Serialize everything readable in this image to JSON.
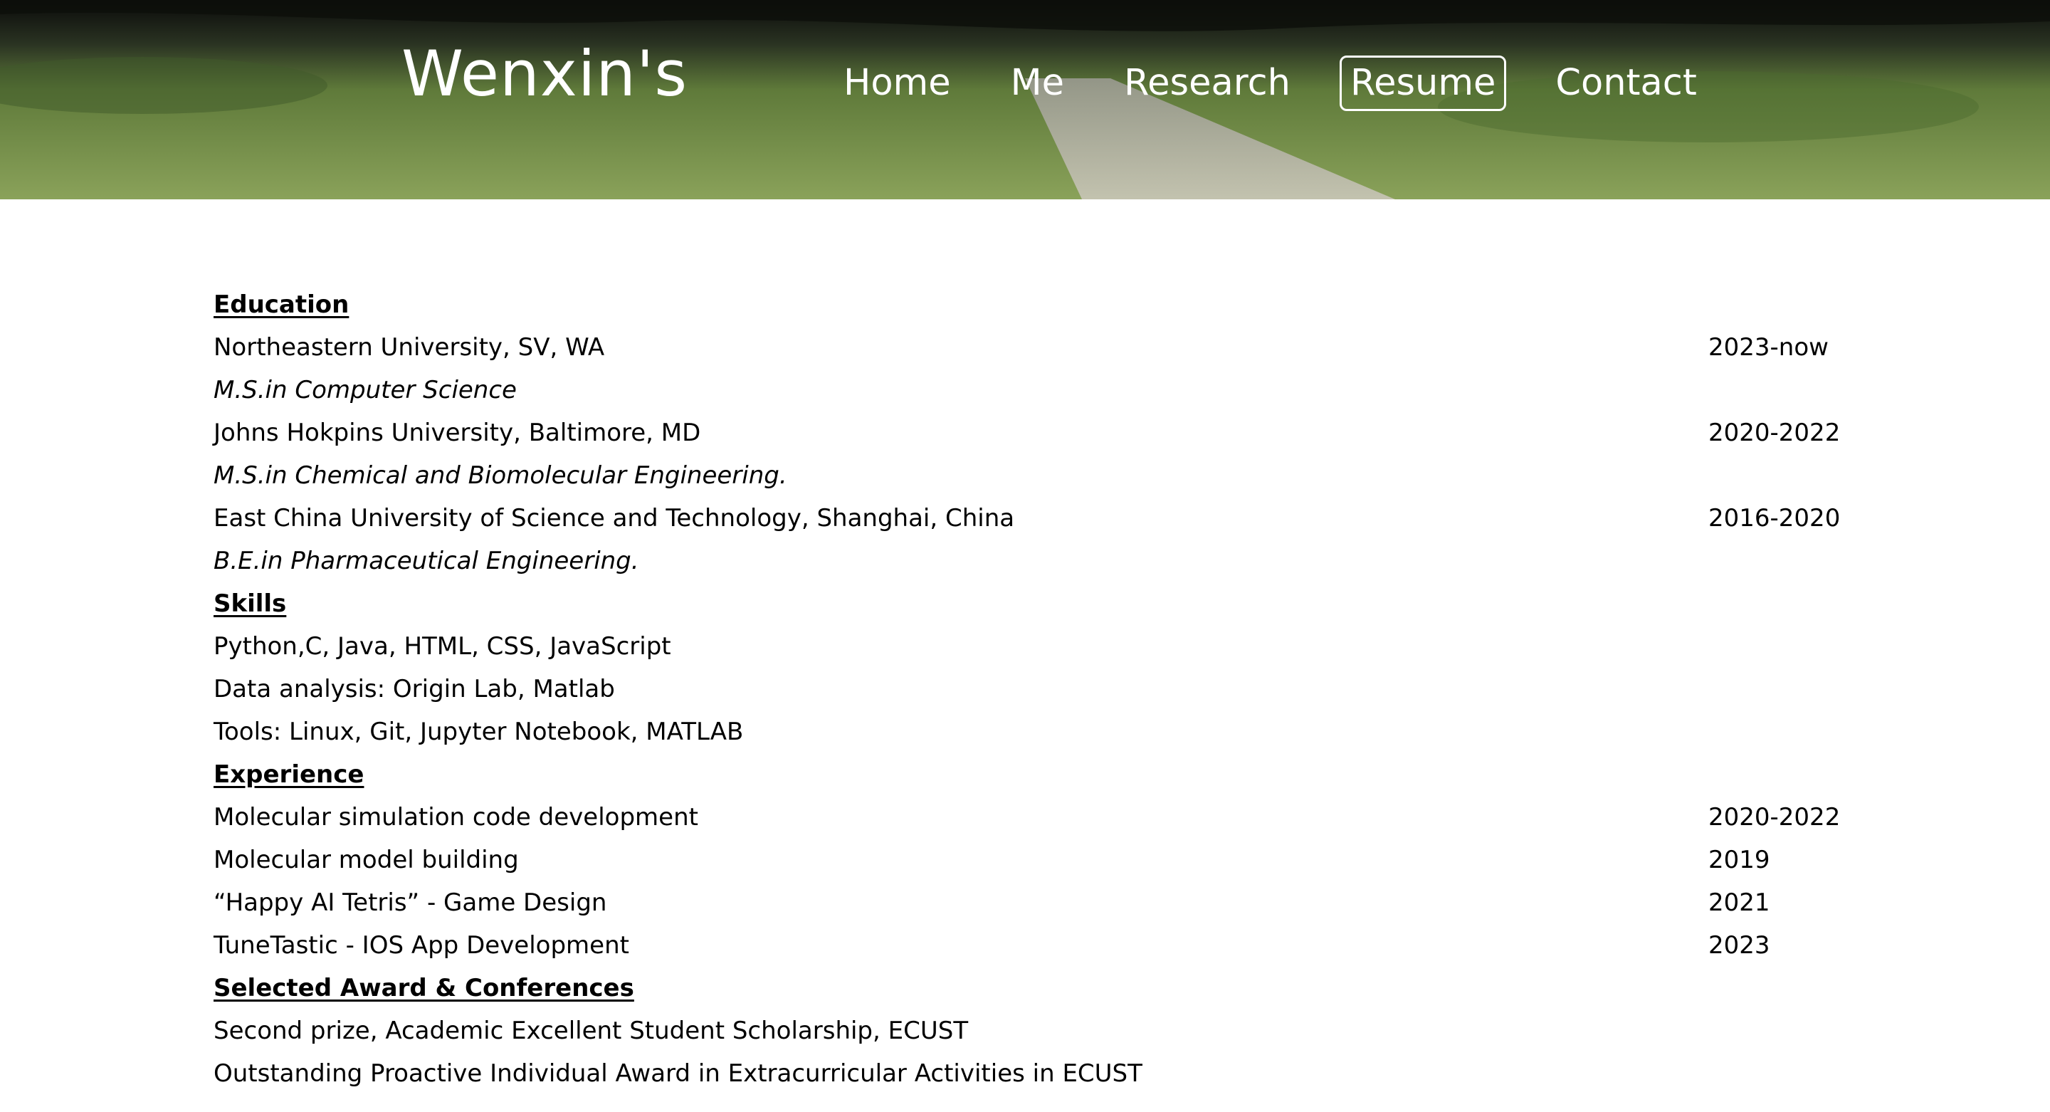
{
  "header": {
    "site_title": "Wenxin's",
    "nav": [
      {
        "label": "Home",
        "active": false
      },
      {
        "label": "Me",
        "active": false
      },
      {
        "label": "Research",
        "active": false
      },
      {
        "label": "Resume",
        "active": true
      },
      {
        "label": "Contact",
        "active": false
      }
    ]
  },
  "resume": {
    "education": {
      "heading": "Education",
      "entries": [
        {
          "school": "Northeastern University, SV, WA",
          "years": "2023-now",
          "degree": "M.S.in Computer Science"
        },
        {
          "school": "Johns Hokpins University, Baltimore, MD",
          "years": "2020-2022",
          "degree": "M.S.in Chemical and Biomolecular Engineering."
        },
        {
          "school": "East China University of Science and Technology, Shanghai, China",
          "years": "2016-2020",
          "degree": "B.E.in Pharmaceutical Engineering."
        }
      ]
    },
    "skills": {
      "heading": "Skills",
      "items": [
        "Python,C, Java, HTML, CSS, JavaScript",
        "Data analysis: Origin Lab, Matlab",
        "Tools: Linux, Git, Jupyter Notebook, MATLAB"
      ]
    },
    "experience": {
      "heading": "Experience",
      "items": [
        {
          "title": "Molecular simulation code development",
          "years": "2020-2022"
        },
        {
          "title": "Molecular model building",
          "years": "2019"
        },
        {
          "title": "“Happy AI Tetris” - Game Design",
          "years": "2021"
        },
        {
          "title": "TuneTastic - IOS App Development",
          "years": "2023"
        }
      ]
    },
    "awards": {
      "heading": "Selected Award & Conferences",
      "items": [
        "Second prize, Academic Excellent Student Scholarship, ECUST",
        "Outstanding Proactive Individual Award in Extracurricular Activities in ECUST"
      ]
    }
  }
}
